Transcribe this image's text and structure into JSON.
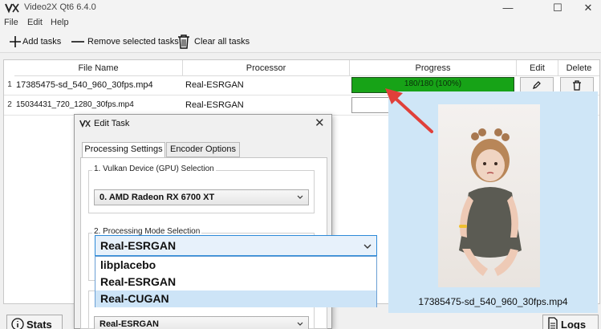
{
  "app": {
    "title": "Video2X Qt6 6.4.0",
    "logo_icon": "video2x-logo-icon",
    "window_controls": {
      "minimize": "—",
      "maximize": "☐",
      "close": "✕"
    }
  },
  "menu": [
    "File",
    "Edit",
    "Help"
  ],
  "toolbar": {
    "add_label": "Add tasks",
    "remove_label": "Remove selected tasks",
    "clear_label": "Clear all tasks"
  },
  "table": {
    "columns": [
      "File Name",
      "Processor",
      "Progress",
      "Edit",
      "Delete"
    ],
    "rows": [
      {
        "num": "1",
        "file": "17385475-sd_540_960_30fps.mp4",
        "processor": "Real-ESRGAN",
        "progress_text": "180/180 (100%)",
        "progress": 1.0
      },
      {
        "num": "2",
        "file": "15034431_720_1280_30fps.mp4",
        "processor": "Real-ESRGAN",
        "progress_text": "",
        "progress": 0.0
      }
    ]
  },
  "bottom": {
    "stats_label": "Stats",
    "logs_label": "Logs"
  },
  "preview": {
    "caption": "17385475-sd_540_960_30fps.mp4"
  },
  "dialog": {
    "title": "Edit Task",
    "tabs": [
      "Processing Settings",
      "Encoder Options"
    ],
    "gpu_group_label": "1. Vulkan Device (GPU) Selection",
    "gpu_value": "0. AMD Radeon RX 6700 XT",
    "mode_group_label": "2. Processing Mode Selection",
    "mode_value": "Real-ESRGAN",
    "mode_options": [
      "libplacebo",
      "Real-ESRGAN",
      "Real-CUGAN"
    ],
    "mode_highlighted": "Real-CUGAN",
    "bottom_combo_value": "Real-ESRGAN"
  },
  "colors": {
    "progress_fill": "#17a317",
    "preview_bg": "#cfe6f7",
    "arrow": "#e0403a",
    "highlight": "#cde4f7"
  }
}
